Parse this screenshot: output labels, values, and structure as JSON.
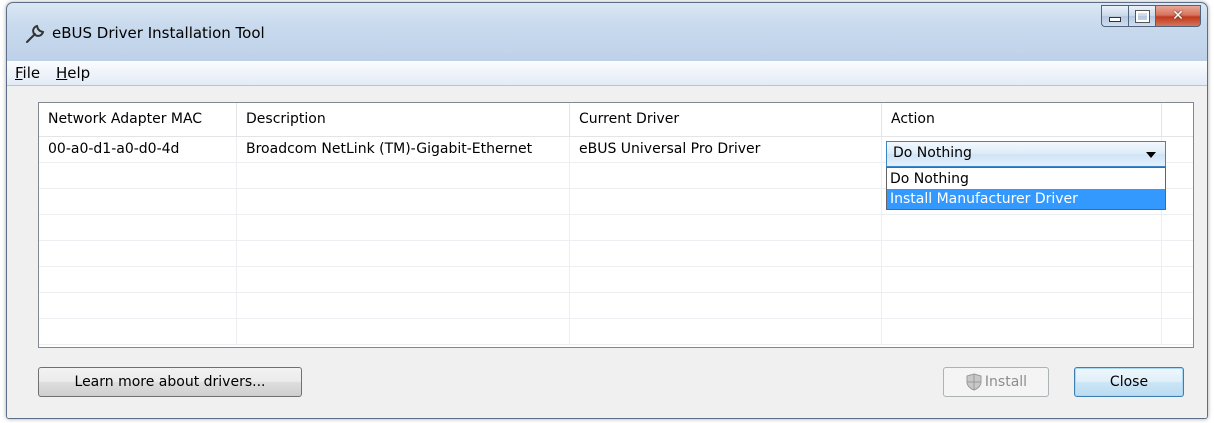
{
  "window": {
    "title": "eBUS Driver Installation Tool",
    "title_icon": "wrench-icon",
    "caption_buttons": [
      "minimize",
      "maximize",
      "close"
    ]
  },
  "menu": {
    "file": {
      "label": "File",
      "mnemonic": "F",
      "rest": "ile"
    },
    "help": {
      "label": "Help",
      "mnemonic": "H",
      "rest": "elp"
    }
  },
  "grid": {
    "columns": [
      "Network Adapter MAC",
      "Description",
      "Current Driver",
      "Action"
    ],
    "rows": [
      {
        "mac": "00-a0-d1-a0-d0-4d",
        "description": "Broadcom NetLink (TM)-Gigabit-Ethernet",
        "current_driver": "eBUS Universal Pro Driver",
        "action": "Do Nothing"
      }
    ]
  },
  "action_dropdown": {
    "selected": "Do Nothing",
    "options": [
      "Do Nothing",
      "Install Manufacturer Driver"
    ],
    "highlighted": "Install Manufacturer Driver"
  },
  "buttons": {
    "learn_more": "Learn more about drivers...",
    "install": "Install",
    "close": "Close"
  },
  "colors": {
    "selection_highlight": "#3399ff",
    "combo_border": "#3b85c8"
  }
}
